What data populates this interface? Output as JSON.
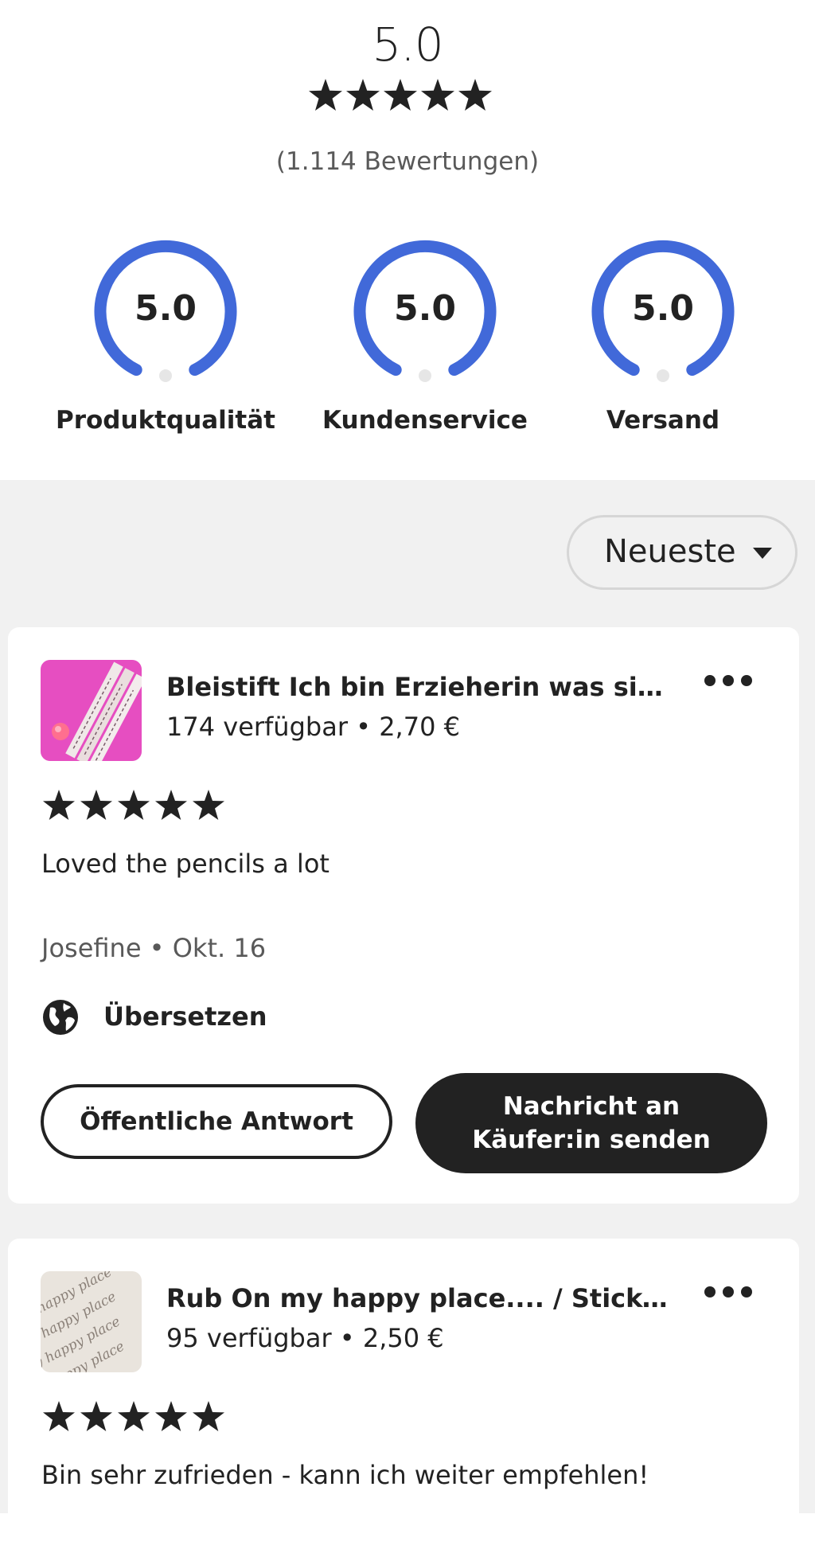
{
  "summary": {
    "average": "5.0",
    "stars": 5,
    "count_text": "(1.114 Bewertungen)"
  },
  "gauges": [
    {
      "value": "5.0",
      "label": "Produktqualität"
    },
    {
      "value": "5.0",
      "label": "Kundenservice"
    },
    {
      "value": "5.0",
      "label": "Versand"
    }
  ],
  "sort": {
    "label": "Neueste"
  },
  "reviews": [
    {
      "product_title": "Bleistift Ich bin Erzieherin was sind ...",
      "availability": "174 verfügbar",
      "separator": "•",
      "price": "2,70 €",
      "rating": 5,
      "text": "Loved the pencils a lot",
      "reviewer": "Josefine",
      "date": "Okt. 16",
      "translate_label": "Übersetzen",
      "public_reply_label": "Öffentliche Antwort",
      "message_label": "Nachricht an Käufer:in senden"
    },
    {
      "product_title": "Rub On my happy place.... / Sticker ...",
      "availability": "95 verfügbar",
      "separator": "•",
      "price": "2,50 €",
      "rating": 5,
      "text": "Bin sehr zufrieden - kann ich weiter empfehlen!"
    }
  ],
  "thumb_texts": [
    "my happy place",
    "my happy place",
    "my happy place",
    "my happy place"
  ],
  "colors": {
    "accent": "#4169d9",
    "text": "#222222",
    "muted": "#595959",
    "background": "#f1f1f1",
    "thumb_pink": "#e040b8"
  },
  "icons": {
    "star": "star-icon",
    "more": "more-icon",
    "globe": "globe-icon",
    "caret": "caret-down-icon"
  }
}
